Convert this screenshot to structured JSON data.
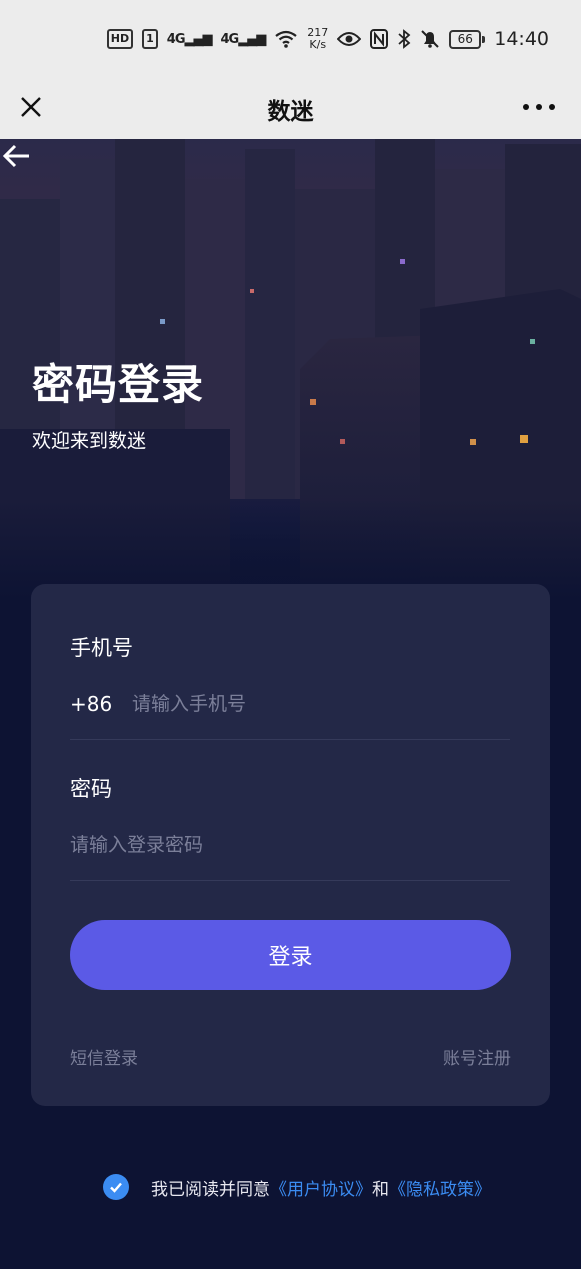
{
  "status_bar": {
    "hd": "HD",
    "sim": "1",
    "net1": "4G",
    "net2": "4G",
    "speed_value": "217",
    "speed_unit": "K/s",
    "battery": "66",
    "time": "14:40"
  },
  "title_bar": {
    "title": "数迷"
  },
  "hero": {
    "title": "密码登录",
    "subtitle": "欢迎来到数迷"
  },
  "form": {
    "phone_label": "手机号",
    "country_code": "+86",
    "phone_placeholder": "请输入手机号",
    "password_label": "密码",
    "password_placeholder": "请输入登录密码",
    "login_label": "登录",
    "sms_login": "短信登录",
    "register": "账号注册"
  },
  "agreement": {
    "prefix": "我已阅读并同意",
    "user_agreement": "《用户协议》",
    "and": "和",
    "privacy_policy": "《隐私政策》",
    "checked": true
  },
  "colors": {
    "accent": "#5b5ae6",
    "link": "#3b8cf2",
    "card": "#232847",
    "background": "#0d1333"
  }
}
